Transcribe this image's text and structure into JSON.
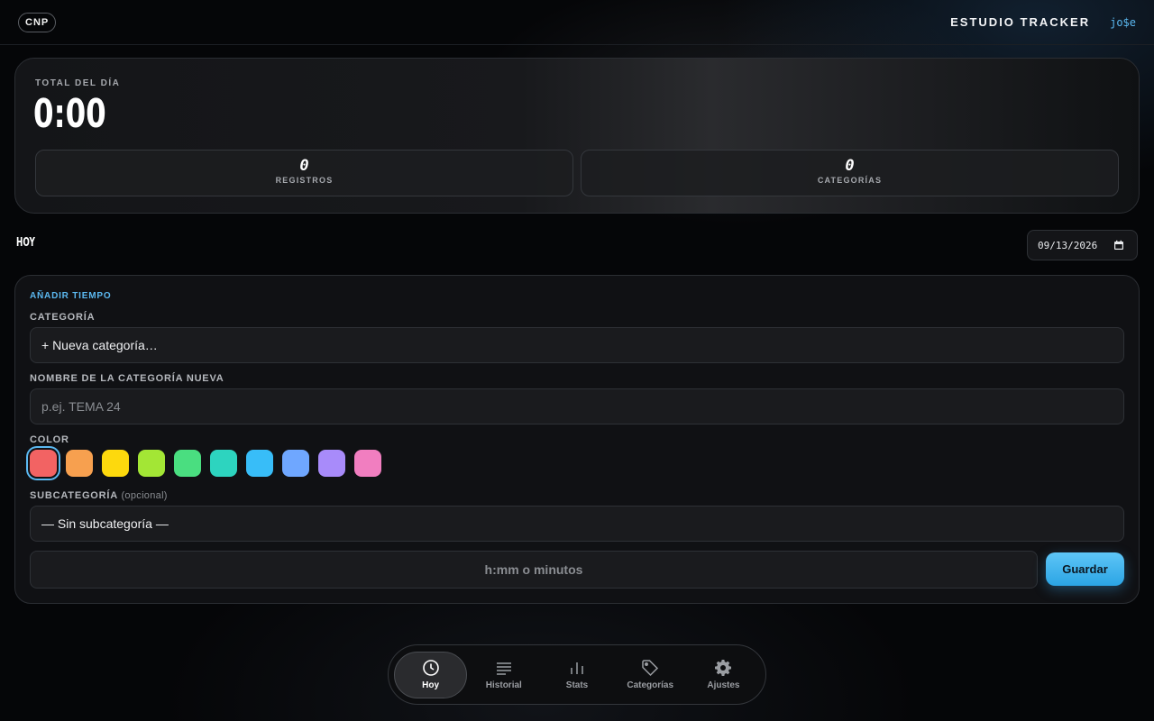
{
  "header": {
    "logo": "CNP",
    "app_title": "ESTUDIO TRACKER",
    "user": "jo$e"
  },
  "summary": {
    "total_label": "TOTAL DEL DÍA",
    "total_value": "0:00",
    "stats": [
      {
        "value": "0",
        "label": "REGISTROS"
      },
      {
        "value": "0",
        "label": "CATEGORÍAS"
      }
    ]
  },
  "day": {
    "label": "HOY",
    "date": "09/13/2026"
  },
  "form": {
    "title": "AÑADIR TIEMPO",
    "category_label": "CATEGORÍA",
    "category_value": "+ Nueva categoría…",
    "new_category_label": "NOMBRE DE LA CATEGORÍA NUEVA",
    "new_category_placeholder": "p.ej. TEMA 24",
    "color_label": "COLOR",
    "colors": [
      "#f26363",
      "#f7a04f",
      "#fdd90d",
      "#a3e635",
      "#4ade80",
      "#2dd4bf",
      "#38bdf8",
      "#6fa7ff",
      "#a88bfa",
      "#f17ec0"
    ],
    "selected_color_index": 0,
    "subcategory_label": "SUBCATEGORÍA",
    "subcategory_optional": "(opcional)",
    "subcategory_value": "— Sin subcategoría —",
    "time_placeholder": "h:mm o minutos",
    "save_label": "Guardar"
  },
  "nav": {
    "items": [
      {
        "label": "Hoy",
        "icon": "clock-icon",
        "active": true
      },
      {
        "label": "Historial",
        "icon": "list-icon",
        "active": false
      },
      {
        "label": "Stats",
        "icon": "bar-chart-icon",
        "active": false
      },
      {
        "label": "Categorías",
        "icon": "tag-icon",
        "active": false
      },
      {
        "label": "Ajustes",
        "icon": "gear-icon",
        "active": false
      }
    ]
  }
}
